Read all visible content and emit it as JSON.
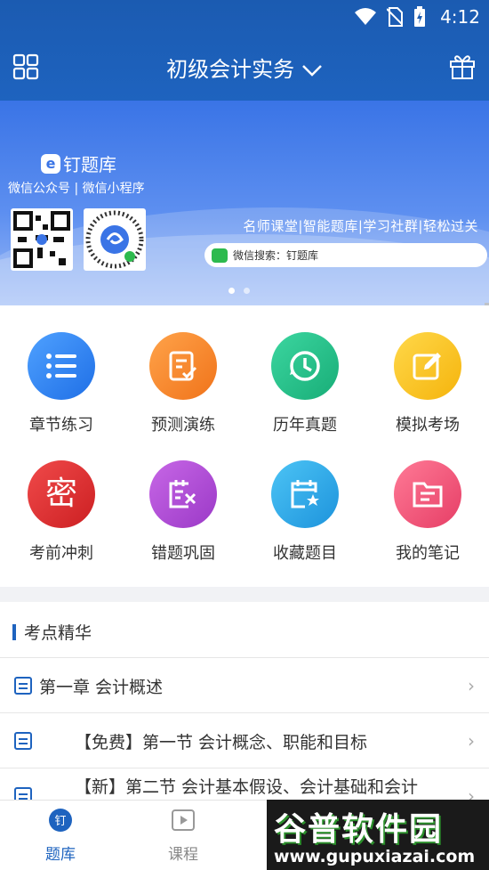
{
  "status": {
    "time": "4:12"
  },
  "header": {
    "title": "初级会计实务"
  },
  "banner": {
    "brand": "钉题库",
    "brand_sub": "微信公众号 | 微信小程序",
    "slogan": "名师课堂|智能题库|学习社群|轻松过关",
    "search_text": "微信搜索：钉题库",
    "dots_total": 2,
    "dots_active": 0
  },
  "grid": [
    {
      "label": "章节练习",
      "icon": "list-icon",
      "color": "#2f86f0"
    },
    {
      "label": "预测演练",
      "icon": "clipboard-check-icon",
      "color": "#f5892a"
    },
    {
      "label": "历年真题",
      "icon": "history-clock-icon",
      "color": "#27c18c"
    },
    {
      "label": "模拟考场",
      "icon": "edit-icon",
      "color": "#f7c51d"
    },
    {
      "label": "考前冲刺",
      "icon": "secret-mi-icon",
      "color": "#e53b3b"
    },
    {
      "label": "错题巩固",
      "icon": "calendar-x-icon",
      "color": "#b44fd8"
    },
    {
      "label": "收藏题目",
      "icon": "calendar-star-icon",
      "color": "#2aa9ea"
    },
    {
      "label": "我的笔记",
      "icon": "folder-note-icon",
      "color": "#f0577a"
    }
  ],
  "section": {
    "title": "考点精华",
    "rows": [
      {
        "text": "第一章 会计概述"
      },
      {
        "text": "【免费】第一节 会计概念、职能和目标"
      },
      {
        "text": "【新】第二节 会计基本假设、会计基础和会计"
      }
    ]
  },
  "tabs": [
    {
      "label": "题库",
      "icon": "quiz-bank-icon"
    },
    {
      "label": "课程",
      "icon": "video-play-icon"
    }
  ],
  "watermark": {
    "big": "谷普软件园",
    "small": "www.gupuxiazai.com"
  },
  "colors": {
    "primary": "#1e63bf",
    "header": "#1b5bb1"
  }
}
